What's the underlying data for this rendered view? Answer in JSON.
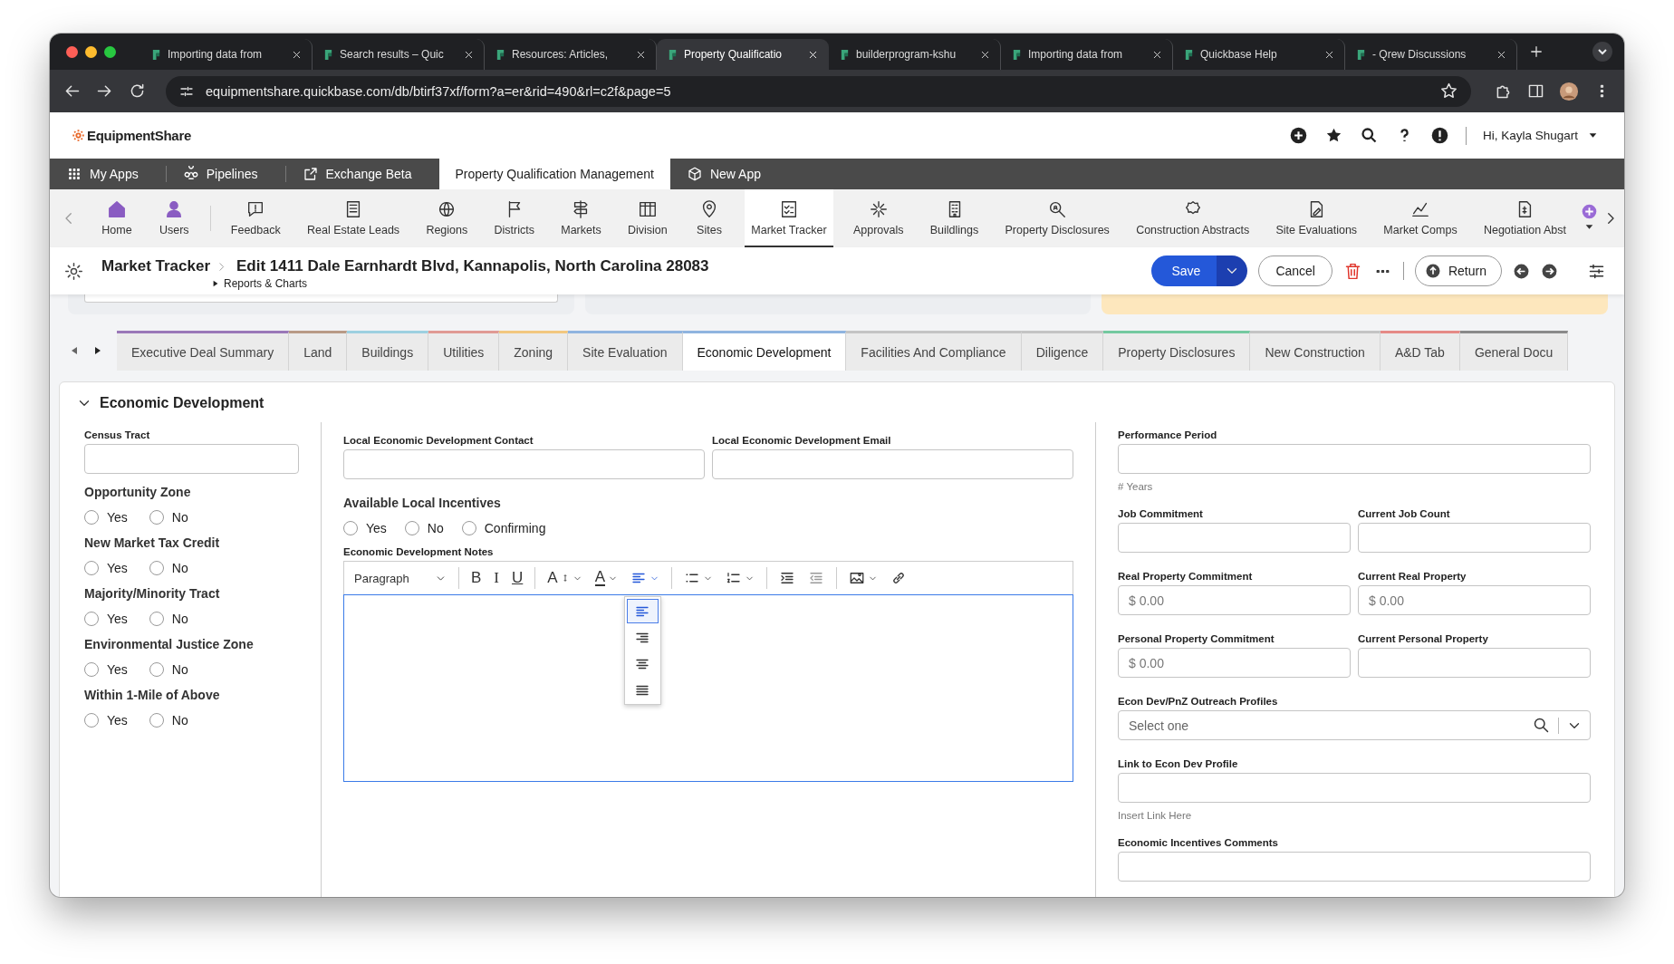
{
  "browser": {
    "tabs": [
      {
        "title": "Importing data from",
        "selected": false
      },
      {
        "title": "Search results – Quic",
        "selected": false
      },
      {
        "title": "Resources: Articles,",
        "selected": false
      },
      {
        "title": "Property Qualificatio",
        "selected": true
      },
      {
        "title": "builderprogram-kshu",
        "selected": false
      },
      {
        "title": "Importing data from",
        "selected": false
      },
      {
        "title": "Quickbase Help",
        "selected": false
      },
      {
        "title": "- Qrew Discussions",
        "selected": false
      }
    ],
    "url": "equipmentshare.quickbase.com/db/btirf37xf/form?a=er&rid=490&rl=c2f&page=5"
  },
  "app_header": {
    "logo": "EquipmentShare",
    "greeting": "Hi, Kayla Shugart"
  },
  "app_bar": {
    "items": [
      {
        "label": "My Apps",
        "selected": false
      },
      {
        "label": "Pipelines",
        "selected": false
      },
      {
        "label": "Exchange Beta",
        "selected": false
      },
      {
        "label": "Property Qualification Management",
        "selected": true
      },
      {
        "label": "New App",
        "selected": false
      }
    ]
  },
  "nav": {
    "items": [
      {
        "label": "Home",
        "selected": false
      },
      {
        "label": "Users",
        "selected": false
      },
      {
        "label": "Feedback",
        "selected": false
      },
      {
        "label": "Real Estate Leads",
        "selected": false
      },
      {
        "label": "Regions",
        "selected": false
      },
      {
        "label": "Districts",
        "selected": false
      },
      {
        "label": "Markets",
        "selected": false
      },
      {
        "label": "Division",
        "selected": false
      },
      {
        "label": "Sites",
        "selected": false
      },
      {
        "label": "Market Tracker",
        "selected": true
      },
      {
        "label": "Approvals",
        "selected": false
      },
      {
        "label": "Buildlings",
        "selected": false
      },
      {
        "label": "Property Disclosures",
        "selected": false
      },
      {
        "label": "Construction Abstracts",
        "selected": false
      },
      {
        "label": "Site Evaluations",
        "selected": false
      },
      {
        "label": "Market Comps",
        "selected": false
      },
      {
        "label": "Negotiation Abst",
        "selected": false
      }
    ]
  },
  "record": {
    "table": "Market Tracker",
    "title": "Edit 1411 Dale Earnhardt Blvd, Kannapolis, North Carolina 28083",
    "link": "Reports & Charts",
    "save": "Save",
    "cancel": "Cancel",
    "return": "Return"
  },
  "summary_cards": [
    {
      "color": "#eceef1"
    },
    {
      "color": "#eceef1"
    },
    {
      "color": "#fde7bd"
    }
  ],
  "form_tabs": [
    {
      "label": "Executive Deal Summary",
      "color": "#9a78b8",
      "selected": false
    },
    {
      "label": "Land",
      "color": "#b89a86",
      "selected": false
    },
    {
      "label": "Buildings",
      "color": "#9dd0e0",
      "selected": false
    },
    {
      "label": "Utilities",
      "color": "#e09a94",
      "selected": false
    },
    {
      "label": "Zoning",
      "color": "#f2c77f",
      "selected": false
    },
    {
      "label": "Site Evaluation",
      "color": "#8fb4df",
      "selected": false
    },
    {
      "label": "Economic Development",
      "color": "#8fb4df",
      "selected": true
    },
    {
      "label": "Facilities And Compliance",
      "color": "#c4c4c4",
      "selected": false
    },
    {
      "label": "Diligence",
      "color": "#c4c4c4",
      "selected": false
    },
    {
      "label": "Property Disclosures",
      "color": "#74c9a0",
      "selected": false
    },
    {
      "label": "New Construction",
      "color": "#c4c4c4",
      "selected": false
    },
    {
      "label": "A&D Tab",
      "color": "#e58a86",
      "selected": false
    },
    {
      "label": "General Docu",
      "color": "#8a8a8a",
      "selected": false
    }
  ],
  "section": {
    "title": "Economic Development",
    "expanded": true,
    "left": [
      {
        "kind": "text",
        "label": "Census Tract"
      },
      {
        "kind": "radio",
        "label": "Opportunity Zone",
        "options": [
          {
            "label": "Yes",
            "selected": false
          },
          {
            "label": "No",
            "selected": false
          }
        ]
      },
      {
        "kind": "radio",
        "label": "New Market Tax Credit",
        "options": [
          {
            "label": "Yes",
            "selected": false
          },
          {
            "label": "No",
            "selected": false
          }
        ]
      },
      {
        "kind": "radio",
        "label": "Majority/Minority Tract",
        "options": [
          {
            "label": "Yes",
            "selected": false
          },
          {
            "label": "No",
            "selected": false
          }
        ]
      },
      {
        "kind": "radio",
        "label": "Environmental Justice Zone",
        "options": [
          {
            "label": "Yes",
            "selected": false
          },
          {
            "label": "No",
            "selected": false
          }
        ]
      },
      {
        "kind": "radio",
        "label": "Within 1-Mile of Above",
        "options": [
          {
            "label": "Yes",
            "selected": false
          },
          {
            "label": "No",
            "selected": false
          }
        ]
      }
    ],
    "middle": {
      "fields": [
        {
          "label": "Local Economic Development Contact"
        },
        {
          "label": "Local Economic Development Email"
        }
      ],
      "incentives": {
        "label": "Available Local Incentives",
        "options": [
          {
            "label": "Yes",
            "selected": false
          },
          {
            "label": "No",
            "selected": false
          },
          {
            "label": "Confirming",
            "selected": false
          }
        ]
      },
      "notes": {
        "label": "Economic Development Notes",
        "toolbar_groups": [
          {
            "tools": [
              {
                "kind": "select",
                "label": "Paragraph"
              }
            ]
          },
          {
            "tools": [
              {
                "kind": "bold",
                "label": "B"
              },
              {
                "kind": "italic",
                "label": "I"
              },
              {
                "kind": "underline",
                "label": "U"
              }
            ]
          },
          {
            "tools": [
              {
                "kind": "size",
                "label": "A"
              },
              {
                "kind": "color",
                "label": "A"
              },
              {
                "kind": "align",
                "menu": [
                  {
                    "kind": "left",
                    "selected": true
                  },
                  {
                    "kind": "right",
                    "selected": false
                  },
                  {
                    "kind": "center",
                    "selected": false
                  },
                  {
                    "kind": "justify",
                    "selected": false
                  }
                ]
              }
            ]
          },
          {
            "tools": [
              {
                "kind": "bullets"
              },
              {
                "kind": "numbers"
              }
            ]
          },
          {
            "tools": [
              {
                "kind": "indent"
              },
              {
                "kind": "outdent"
              }
            ]
          },
          {
            "tools": [
              {
                "kind": "image"
              },
              {
                "kind": "link"
              }
            ]
          }
        ]
      }
    },
    "right": [
      {
        "fields": [
          {
            "kind": "text",
            "label": "Performance Period",
            "hint": "# Years"
          }
        ]
      },
      {
        "fields": [
          {
            "kind": "text",
            "label": "Job Commitment"
          },
          {
            "kind": "text",
            "label": "Current Job Count"
          }
        ]
      },
      {
        "fields": [
          {
            "kind": "text",
            "label": "Real Property Commitment",
            "placeholder": "$ 0.00"
          },
          {
            "kind": "text",
            "label": "Current Real Property",
            "placeholder": "$ 0.00"
          }
        ]
      },
      {
        "fields": [
          {
            "kind": "text",
            "label": "Personal Property Commitment",
            "placeholder": "$ 0.00"
          },
          {
            "kind": "text",
            "label": "Current Personal Property"
          }
        ]
      },
      {
        "fields": [
          {
            "kind": "select",
            "label": "Econ Dev/PnZ Outreach Profiles",
            "placeholder": "Select one"
          }
        ]
      },
      {
        "fields": [
          {
            "kind": "text",
            "label": "Link to Econ Dev Profile",
            "hint": "Insert Link Here"
          }
        ]
      },
      {
        "fields": [
          {
            "kind": "text",
            "label": "Economic Incentives Comments"
          }
        ]
      }
    ]
  }
}
